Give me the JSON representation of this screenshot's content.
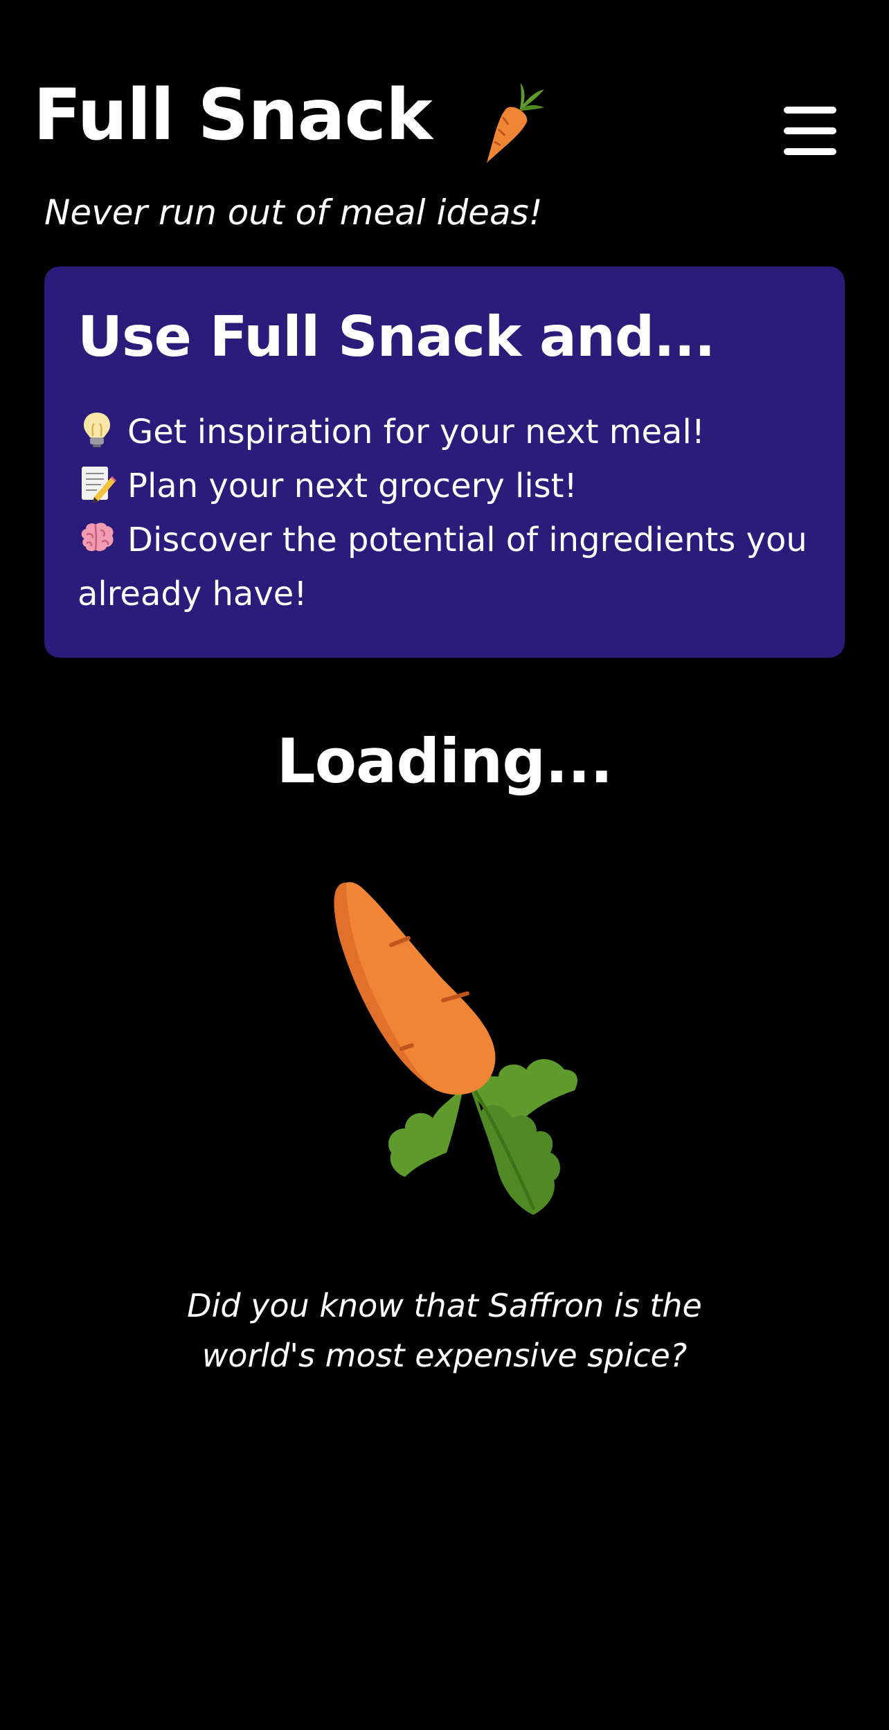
{
  "header": {
    "app_title": "Full Snack",
    "title_icon": "carrot-icon",
    "menu_icon": "hamburger-menu-icon",
    "tagline": "Never run out of meal ideas!"
  },
  "promo": {
    "title": "Use Full Snack and...",
    "items": [
      {
        "icon": "lightbulb-icon",
        "text": "Get inspiration for your next meal!"
      },
      {
        "icon": "memo-pencil-icon",
        "text": "Plan your next grocery list!"
      },
      {
        "icon": "brain-icon",
        "text": "Discover the potential of ingredients you already have!"
      }
    ]
  },
  "loading": {
    "title": "Loading...",
    "icon": "carrot-icon",
    "fun_fact": "Did you know that Saffron is the world's most expensive spice?"
  },
  "colors": {
    "background": "#000000",
    "card": "#2b1b7a",
    "text": "#ffffff",
    "carrot_orange": "#f08535",
    "leaf_green": "#5f9a2c"
  }
}
